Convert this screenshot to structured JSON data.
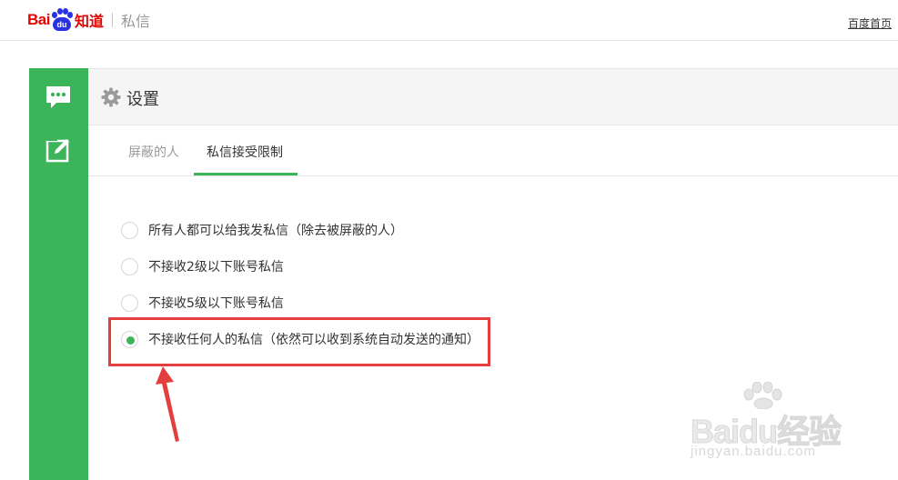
{
  "header": {
    "logo_text_bai": "Bai",
    "logo_text_du": "du",
    "logo_text_product": "知道",
    "section_title": "私信",
    "home_link": "百度首页"
  },
  "sidebar": {
    "items": [
      {
        "icon": "chat-bubble-icon"
      },
      {
        "icon": "edit-icon"
      }
    ],
    "color": "#3cb45a"
  },
  "panel": {
    "title": "设置",
    "title_icon": "gear-icon",
    "tabs": [
      {
        "label": "屏蔽的人",
        "active": false
      },
      {
        "label": "私信接受限制",
        "active": true
      }
    ],
    "options": [
      {
        "label": "所有人都可以给我发私信（除去被屏蔽的人）",
        "selected": false
      },
      {
        "label": "不接收2级以下账号私信",
        "selected": false
      },
      {
        "label": "不接收5级以下账号私信",
        "selected": false
      },
      {
        "label": "不接收任何人的私信（依然可以收到系统自动发送的通知）",
        "selected": true
      }
    ]
  },
  "watermark": {
    "main": "Baidu经验",
    "url": "jingyan.baidu.com"
  },
  "colors": {
    "accent": "#3cb45a",
    "annotation": "#e33f3f",
    "brand_red": "#e10602",
    "brand_blue": "#2932e1"
  }
}
